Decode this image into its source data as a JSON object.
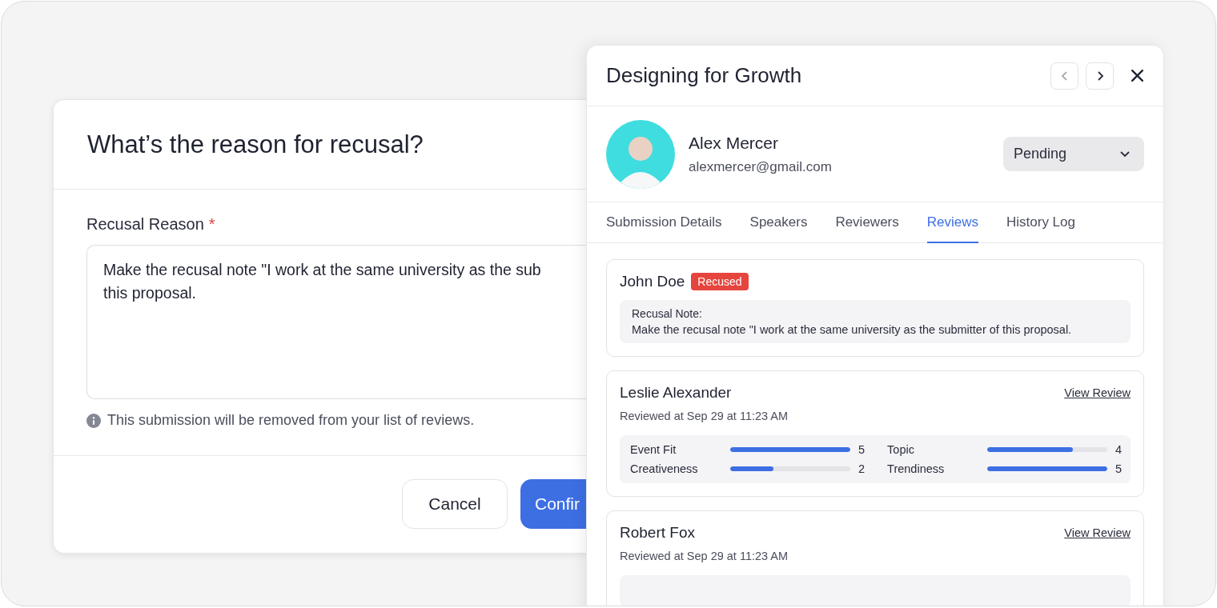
{
  "dialog": {
    "title": "What’s the reason for recusal?",
    "field": {
      "label": "Recusal Reason",
      "required_mark": "*",
      "value_lines": [
        "Make the recusal note \"I work at the same university as the sub",
        "this proposal."
      ]
    },
    "info": "This submission will be removed from your list of reviews.",
    "buttons": [
      {
        "label": "Cancel",
        "kind": "secondary"
      },
      {
        "label": "Confir",
        "kind": "primary"
      }
    ]
  },
  "panel": {
    "title": "Designing for Growth",
    "submitter": {
      "name": "Alex Mercer",
      "email": "alexmercer@gmail.com"
    },
    "status": "Pending",
    "tabs": [
      {
        "label": "Submission Details",
        "selected": false
      },
      {
        "label": "Speakers",
        "selected": false
      },
      {
        "label": "Reviewers",
        "selected": false
      },
      {
        "label": "Reviews",
        "selected": true
      },
      {
        "label": "History Log",
        "selected": false
      }
    ],
    "reviews": [
      {
        "kind": "recused",
        "name": "John Doe",
        "badge": "Recused",
        "note_label": "Recusal Note:",
        "note": "Make the recusal note \"I work at the same university as the submitter of this proposal."
      },
      {
        "kind": "review",
        "name": "Leslie Alexander",
        "link": "View Review",
        "reviewed": "Reviewed at Sep 29 at 11:23 AM",
        "scores": [
          {
            "label": "Event Fit",
            "level": 1,
            "value": "5"
          },
          {
            "label": "Topic",
            "level": 0.71,
            "value": "4"
          },
          {
            "label": "Creativeness",
            "level": 0.36,
            "value": "2"
          },
          {
            "label": "Trendiness",
            "level": 1,
            "value": "5"
          }
        ]
      },
      {
        "kind": "review",
        "name": "Robert Fox",
        "link": "View Review",
        "reviewed": "Reviewed at Sep 29 at 11:23 AM"
      }
    ]
  }
}
